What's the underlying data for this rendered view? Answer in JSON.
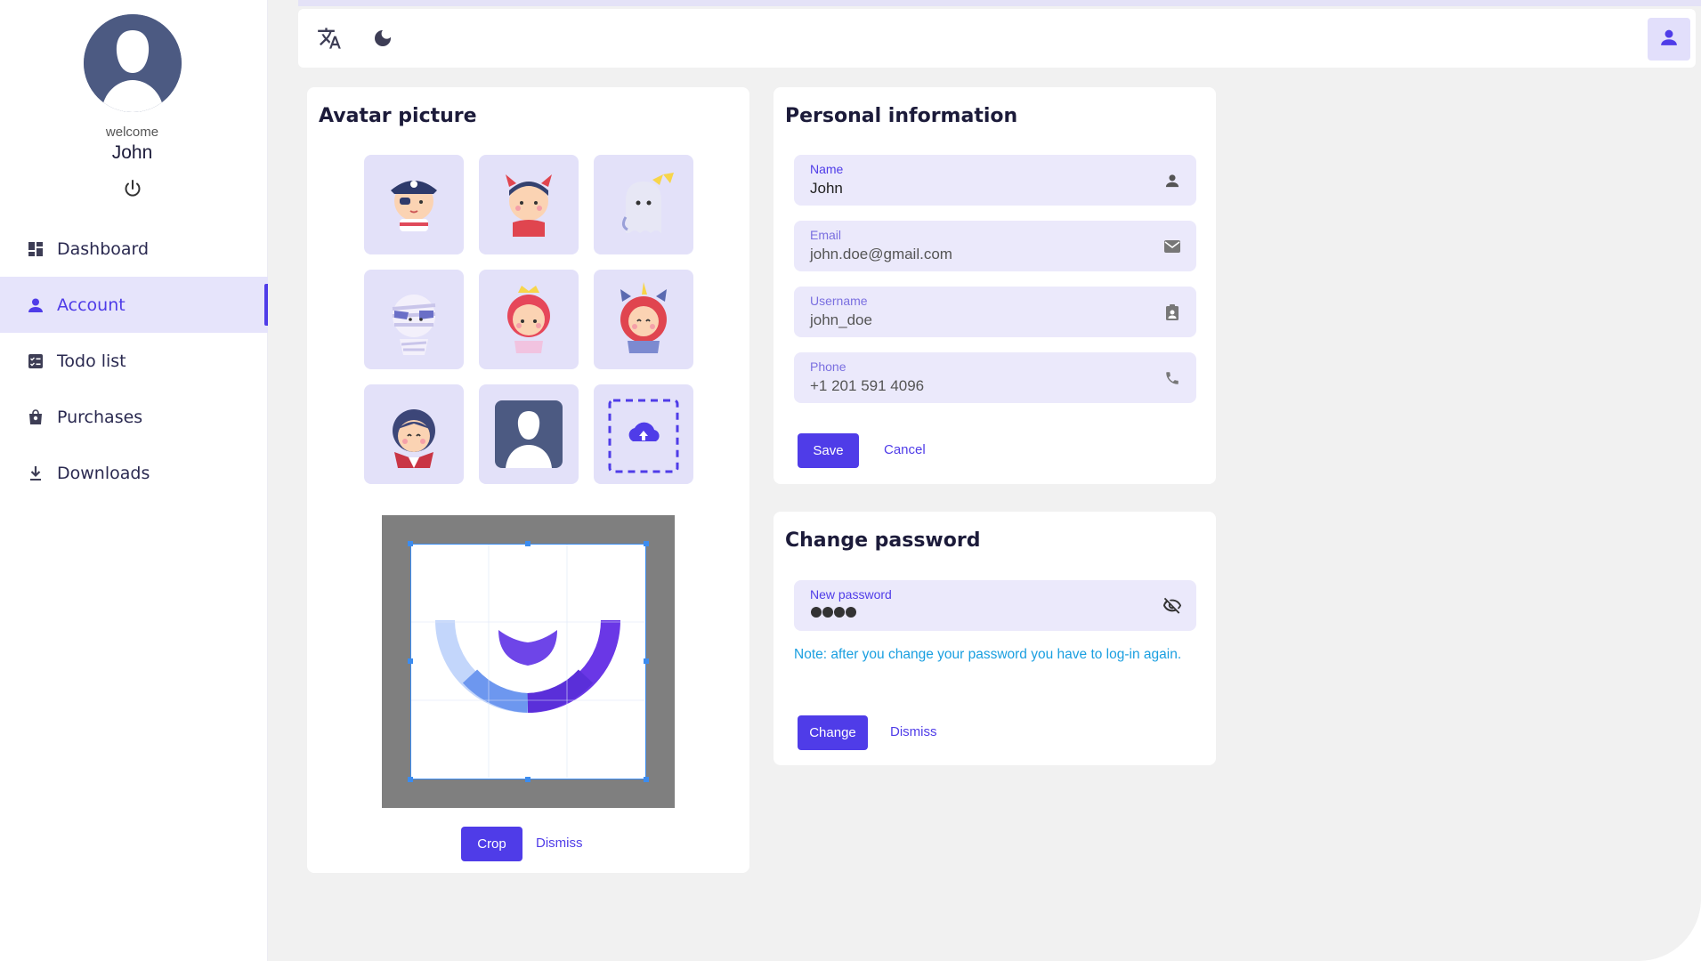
{
  "sidebar": {
    "welcome": "welcome",
    "user_name": "John",
    "nav": [
      {
        "label": "Dashboard",
        "icon": "dashboard-icon",
        "active": false
      },
      {
        "label": "Account",
        "icon": "person-icon",
        "active": true
      },
      {
        "label": "Todo list",
        "icon": "checklist-icon",
        "active": false
      },
      {
        "label": "Purchases",
        "icon": "shopping-bag-icon",
        "active": false
      },
      {
        "label": "Downloads",
        "icon": "download-icon",
        "active": false
      }
    ]
  },
  "topbar": {
    "icons": [
      "translate-icon",
      "dark-mode-icon"
    ],
    "account_icon": "person-icon"
  },
  "avatar_card": {
    "title": "Avatar picture",
    "tiles": [
      "pirate-avatar",
      "devil-avatar",
      "ghost-avatar",
      "mummy-avatar",
      "princess-avatar",
      "unicorn-avatar",
      "vampire-avatar",
      "default-silhouette-avatar",
      "upload-avatar"
    ],
    "crop_label": "Crop",
    "dismiss_label": "Dismiss"
  },
  "personal_info": {
    "title": "Personal information",
    "fields": [
      {
        "label": "Name",
        "value": "John",
        "icon": "person-icon"
      },
      {
        "label": "Email",
        "value": "john.doe@gmail.com",
        "icon": "mail-icon"
      },
      {
        "label": "Username",
        "value": "john_doe",
        "icon": "badge-icon"
      },
      {
        "label": "Phone",
        "value": "+1 201 591 4096",
        "icon": "phone-icon"
      }
    ],
    "save_label": "Save",
    "cancel_label": "Cancel"
  },
  "change_password": {
    "title": "Change password",
    "field_label": "New password",
    "note": "Note: after you change your password you have to log-in again.",
    "change_label": "Change",
    "dismiss_label": "Dismiss"
  },
  "colors": {
    "accent": "#4f3ce8",
    "accent_light": "#e3e1f9",
    "note": "#1a9fe0",
    "main_bg": "#f1f1f1"
  }
}
